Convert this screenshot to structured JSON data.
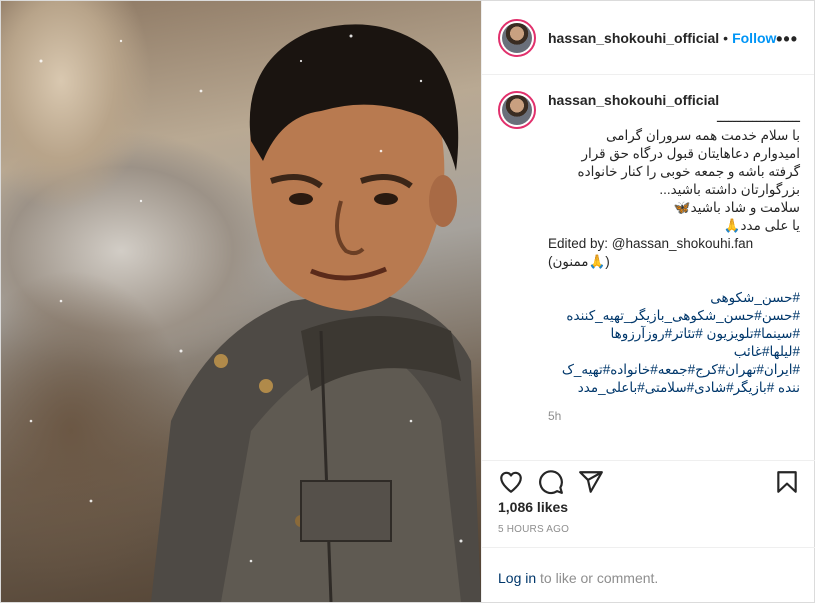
{
  "post": {
    "username": "hassan_shokouhi_official",
    "dot": "•",
    "follow_label": "Follow",
    "more_label": "•••",
    "caption_lines": [
      {
        "text": "ـــــــــــــــــــــ",
        "dir": "rtl"
      },
      {
        "text": "با سلام خدمت همه سروران گرامی",
        "dir": "rtl"
      },
      {
        "text": "امیدوارم دعاهایتان قبول درگاه حق قرار",
        "dir": "rtl"
      },
      {
        "text": "گرفته باشه و جمعه خوبی را کنار خانواده",
        "dir": "rtl"
      },
      {
        "text": "بزرگوارتان داشته باشید...",
        "dir": "rtl"
      },
      {
        "text": "سلامت و شاد باشید🦋",
        "dir": "rtl"
      },
      {
        "text": "یا علی مدد🙏",
        "dir": "rtl"
      },
      {
        "text": "Edited by: @hassan_shokouhi.fan",
        "dir": "ltr"
      },
      {
        "text": "(ممنون🙏)",
        "dir": "ltr"
      }
    ],
    "hashtag_lines": [
      "#حسن_شکوهی",
      "#حسن#حسن_شکوهی_بازیگر_تهیه_کننده",
      "#سینما#تلویزیون #تئاتر#روزآرزوها",
      "#لیلها#غائب",
      "#ایران#تهران#کرج#جمعه#خانواده#تهیه_ک",
      "ننده #بازیگر#شادی#سلامتی#باعلی_مدد"
    ],
    "caption_time": "5h",
    "likes": "1,086 likes",
    "time_ago": "5 HOURS AGO",
    "login_link": "Log in",
    "login_text": " to like or comment.",
    "icons": {
      "like": "heart-icon",
      "comment": "comment-icon",
      "share": "share-icon",
      "save": "bookmark-icon"
    },
    "colors": {
      "follow": "#0095f6",
      "link": "#00376b",
      "muted": "#8e8e8e",
      "story_ring": "#e1306c"
    }
  }
}
